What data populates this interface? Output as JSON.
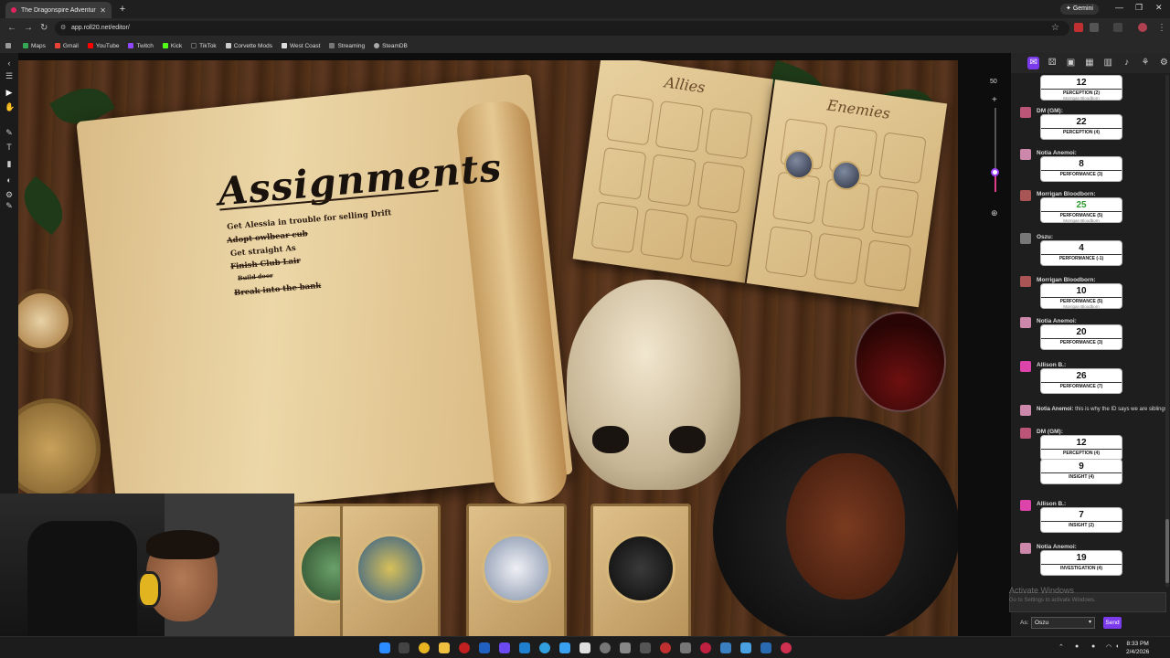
{
  "browser": {
    "tab_title": "The Dragonspire Adventuring",
    "url": "app.roll20.net/editor/",
    "profile_button": "Gemini",
    "bookmarks": [
      "Maps",
      "Gmail",
      "YouTube",
      "Twitch",
      "Kick",
      "TikTok",
      "Corvette Mods",
      "West Coast",
      "Streaming",
      "SteamDB"
    ]
  },
  "canvas": {
    "scroll_title": "Assignments",
    "tasks": [
      {
        "text": "Get Alessia in trouble for selling Drift",
        "done": false
      },
      {
        "text": "Adopt owlbear cub",
        "done": true
      },
      {
        "text": "Get straight As",
        "done": false
      },
      {
        "text": "Finish Club Lair",
        "done": true
      },
      {
        "text": "Build door",
        "done": true
      },
      {
        "text": "Break into the bank",
        "done": true
      }
    ],
    "book_left": "Allies",
    "book_right": "Enemies",
    "zoom": "50"
  },
  "chat": {
    "messages": [
      {
        "speaker": "",
        "value": "12",
        "label": "PERCEPTION (2)",
        "sub": "Morrigan Bloodborn"
      },
      {
        "speaker": "DM (GM):",
        "value": "22",
        "label": "PERCEPTION (4)",
        "sub": ""
      },
      {
        "speaker": "Notia Anemoi:",
        "value": "8",
        "label": "PERFORMANCE (3)",
        "sub": ""
      },
      {
        "speaker": "Morrigan Bloodborn:",
        "value": "25",
        "label": "PERFORMANCE (5)",
        "sub": "Morrigan Bloodborn"
      },
      {
        "speaker": "Oszu:",
        "value": "4",
        "label": "PERFORMANCE (-1)",
        "sub": ""
      },
      {
        "speaker": "Morrigan Bloodborn:",
        "value": "10",
        "label": "PERFORMANCE (5)",
        "sub": "Morrigan Bloodborn"
      },
      {
        "speaker": "Notia Anemoi:",
        "value": "20",
        "label": "PERFORMANCE (3)",
        "sub": ""
      },
      {
        "speaker": "Allison B.:",
        "value": "26",
        "label": "PERFORMANCE (7)",
        "sub": ""
      },
      {
        "speaker": "Notia Anemoi:",
        "text": "this is why the ID says we are siblings"
      },
      {
        "speaker": "DM (GM):",
        "value": "12",
        "label": "PERCEPTION (4)",
        "sub": ""
      },
      {
        "speaker": "",
        "value": "9",
        "label": "INSIGHT (4)",
        "sub": ""
      },
      {
        "speaker": "Allison B.:",
        "value": "7",
        "label": "INSIGHT (2)",
        "sub": ""
      },
      {
        "speaker": "Notia Anemoi:",
        "value": "19",
        "label": "INVESTIGATION (4)",
        "sub": ""
      }
    ],
    "watermark_title": "Activate Windows",
    "watermark_sub": "Go to Settings to activate Windows.",
    "as_label": "As:",
    "as_value": "Oszu",
    "send_label": "Send"
  },
  "taskbar": {
    "time": "8:33 PM",
    "date": "2/4/2026"
  },
  "colors": {
    "accent": "#7c3aed",
    "crit": "#2e9a2e"
  }
}
